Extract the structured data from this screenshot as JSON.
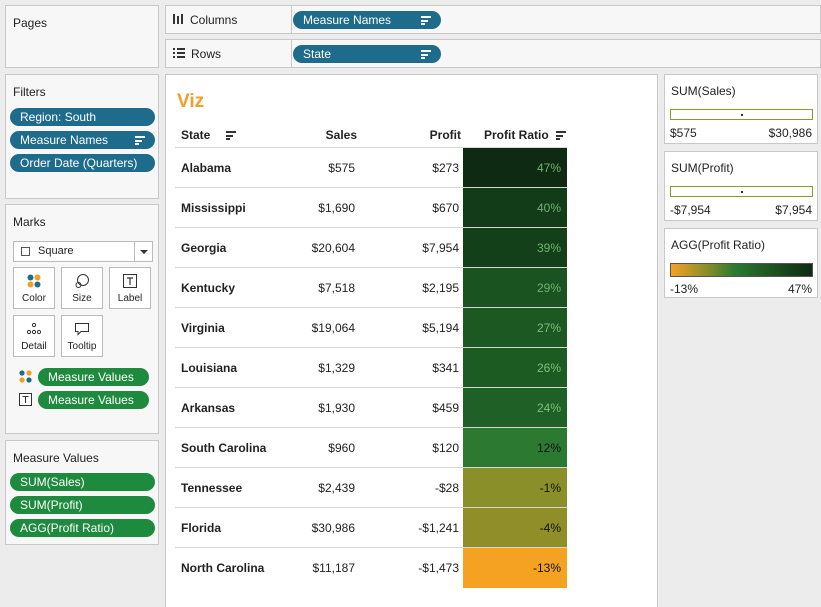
{
  "shelves": {
    "columns_label": "Columns",
    "columns_pill": "Measure Names",
    "rows_label": "Rows",
    "rows_pill": "State"
  },
  "pages": {
    "title": "Pages"
  },
  "filters": {
    "title": "Filters",
    "items": [
      "Region: South",
      "Measure Names",
      "Order Date (Quarters)"
    ]
  },
  "marks": {
    "title": "Marks",
    "type": "Square",
    "buttons": [
      "Color",
      "Size",
      "Label",
      "Detail",
      "Tooltip"
    ],
    "fields": [
      "Measure Values",
      "Measure Values"
    ]
  },
  "measure_values": {
    "title": "Measure Values",
    "items": [
      "SUM(Sales)",
      "SUM(Profit)",
      "AGG(Profit Ratio)"
    ]
  },
  "viz": {
    "title": "Viz",
    "headers": {
      "state": "State",
      "sales": "Sales",
      "profit": "Profit",
      "ratio": "Profit Ratio"
    },
    "rows": [
      {
        "state": "Alabama",
        "sales": "$575",
        "profit": "$273",
        "ratio": "47%",
        "color": "#0f2a12",
        "text": "#6fb36f"
      },
      {
        "state": "Mississippi",
        "sales": "$1,690",
        "profit": "$670",
        "ratio": "40%",
        "color": "#123b17",
        "text": "#6fb36f"
      },
      {
        "state": "Georgia",
        "sales": "$20,604",
        "profit": "$7,954",
        "ratio": "39%",
        "color": "#133f19",
        "text": "#6fb36f"
      },
      {
        "state": "Kentucky",
        "sales": "$7,518",
        "profit": "$2,195",
        "ratio": "29%",
        "color": "#1a5320",
        "text": "#6fb36f"
      },
      {
        "state": "Virginia",
        "sales": "$19,064",
        "profit": "$5,194",
        "ratio": "27%",
        "color": "#1c5822",
        "text": "#7cc07c"
      },
      {
        "state": "Louisiana",
        "sales": "$1,329",
        "profit": "$341",
        "ratio": "26%",
        "color": "#1c5b22",
        "text": "#7cc07c"
      },
      {
        "state": "Arkansas",
        "sales": "$1,930",
        "profit": "$459",
        "ratio": "24%",
        "color": "#1e6026",
        "text": "#7cc07c"
      },
      {
        "state": "South Carolina",
        "sales": "$960",
        "profit": "$120",
        "ratio": "12%",
        "color": "#2c7a31",
        "text": "#111"
      },
      {
        "state": "Tennessee",
        "sales": "$2,439",
        "profit": "-$28",
        "ratio": "-1%",
        "color": "#8b8f2a",
        "text": "#111"
      },
      {
        "state": "Florida",
        "sales": "$30,986",
        "profit": "-$1,241",
        "ratio": "-4%",
        "color": "#8f8e28",
        "text": "#111"
      },
      {
        "state": "North Carolina",
        "sales": "$11,187",
        "profit": "-$1,473",
        "ratio": "-13%",
        "color": "#f5a223",
        "text": "#111"
      }
    ]
  },
  "legends": {
    "sales": {
      "title": "SUM(Sales)",
      "min": "$575",
      "max": "$30,986"
    },
    "profit": {
      "title": "SUM(Profit)",
      "min": "-$7,954",
      "max": "$7,954"
    },
    "ratio": {
      "title": "AGG(Profit Ratio)",
      "min": "-13%",
      "max": "47%",
      "gradient_from": "#f5a223",
      "gradient_mid": "#2c7a31",
      "gradient_to": "#0f2a12"
    }
  }
}
